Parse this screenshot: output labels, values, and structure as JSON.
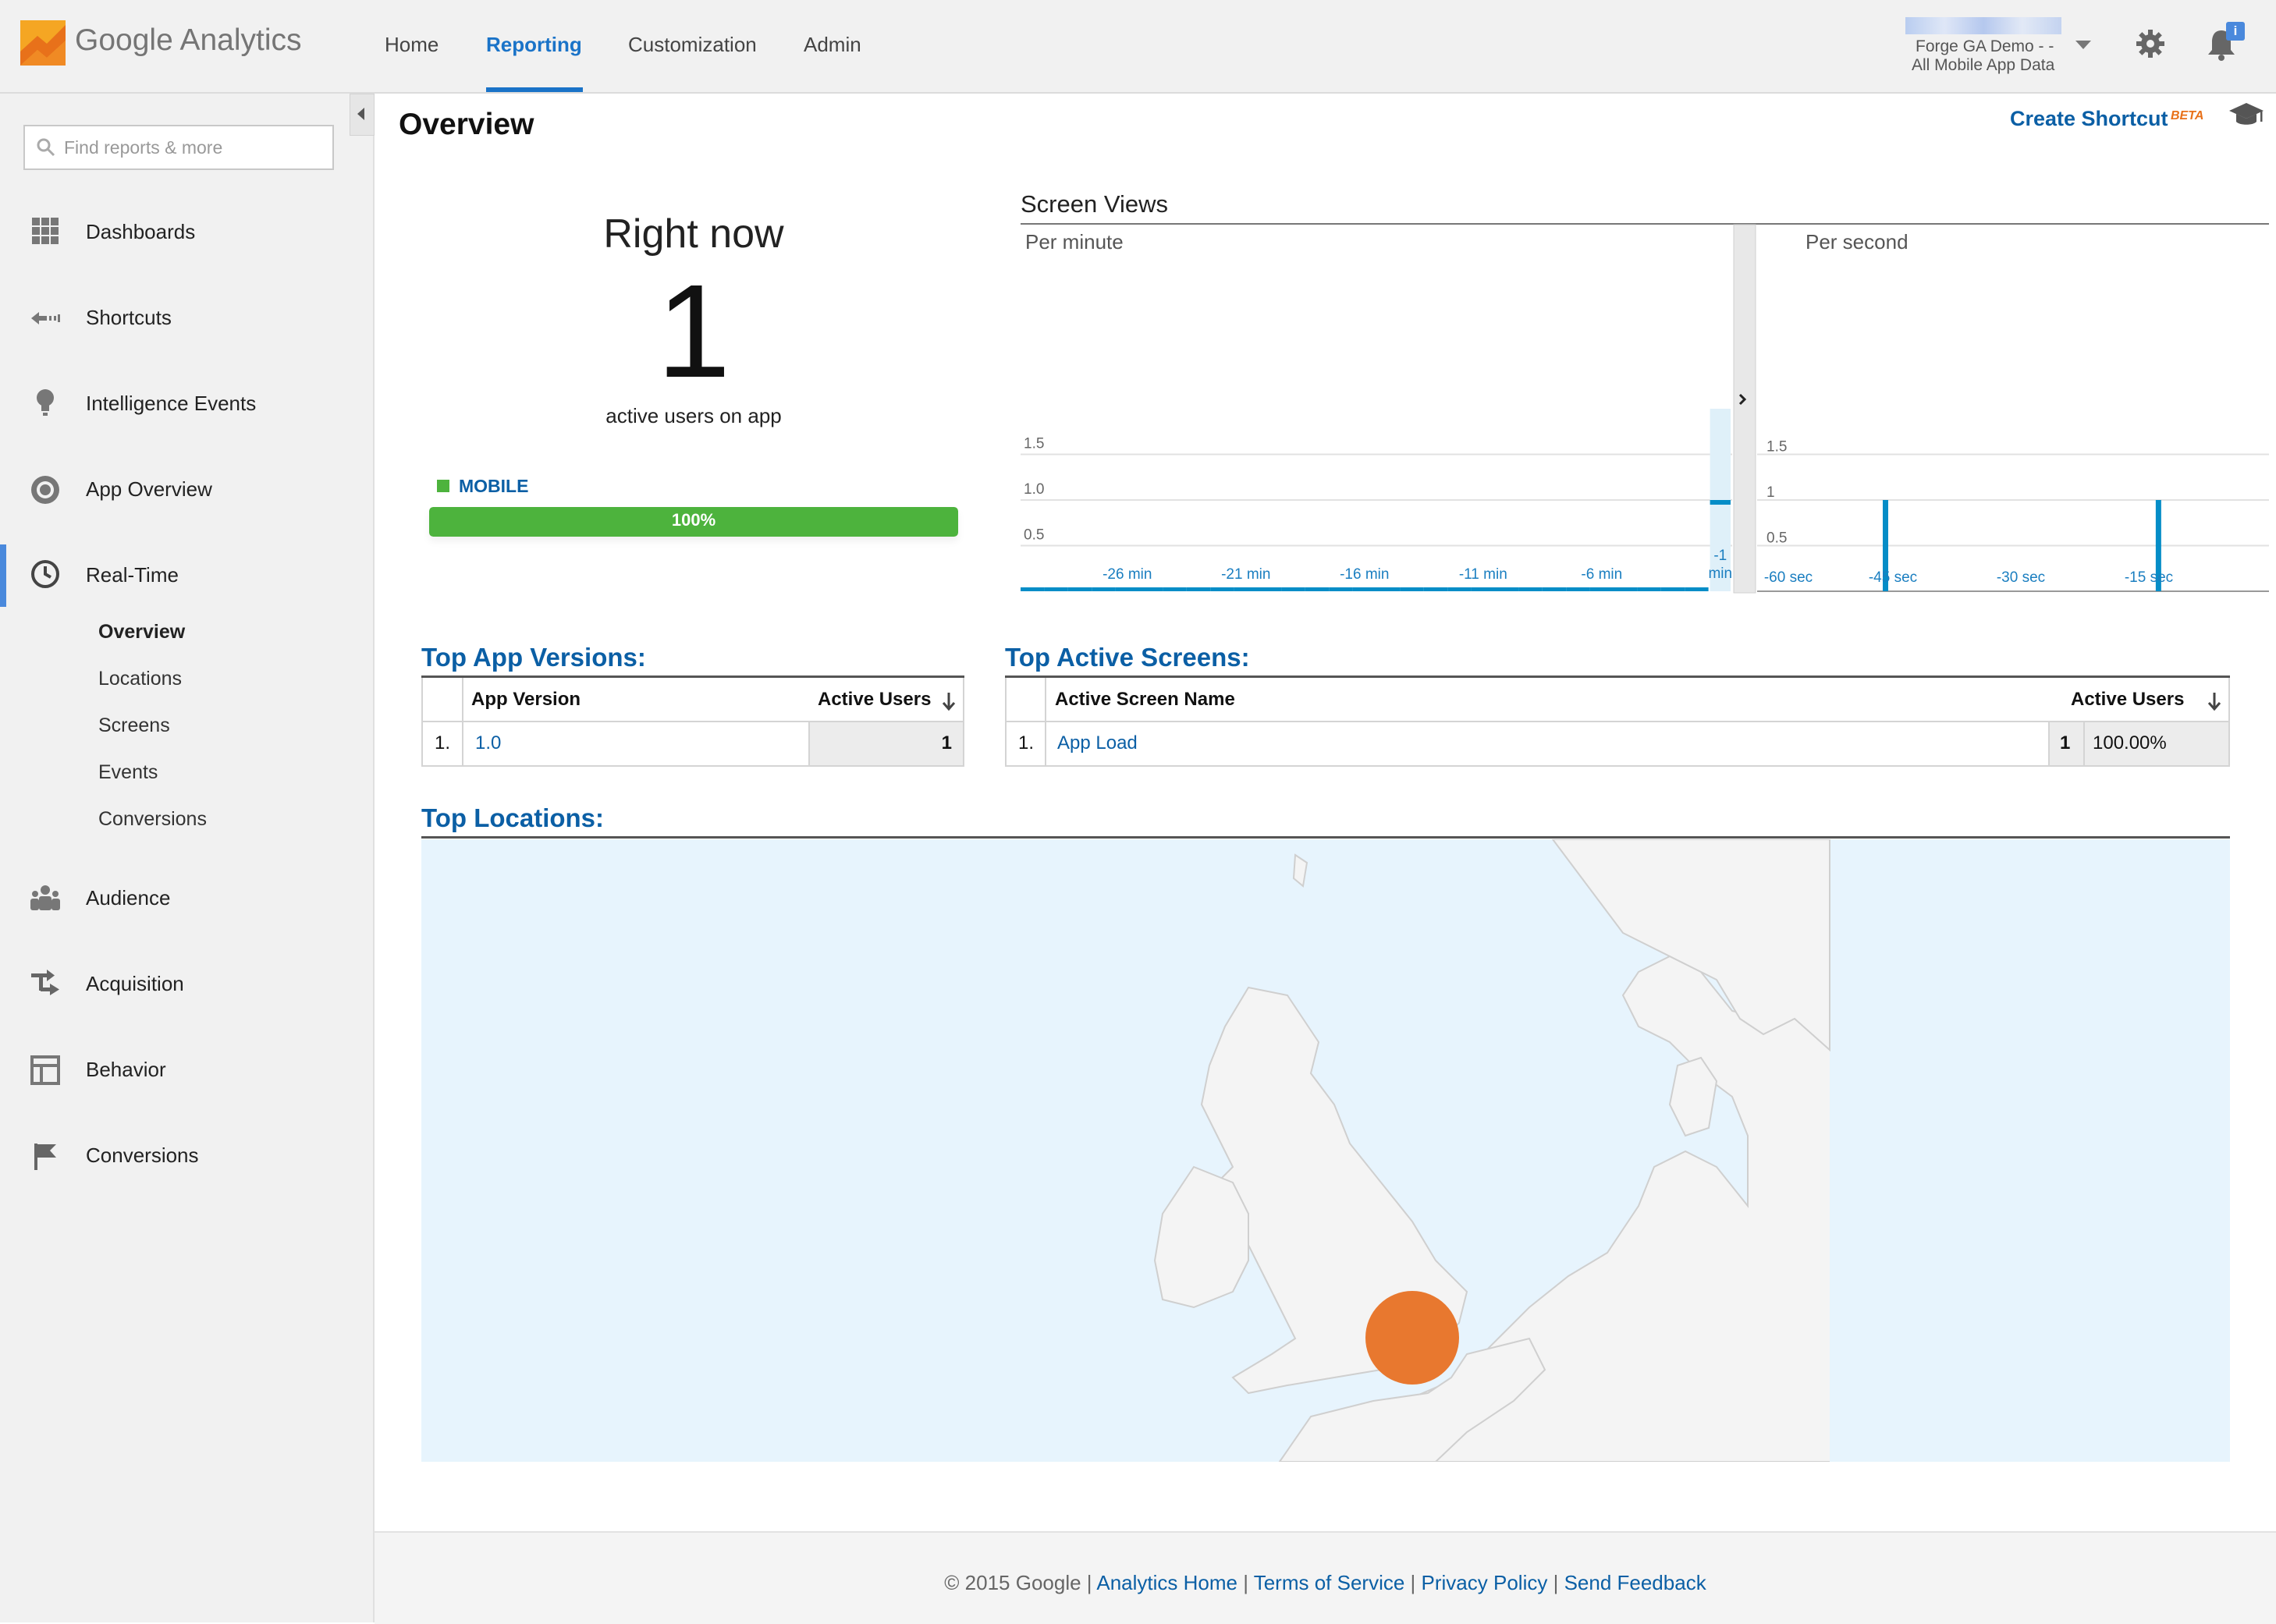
{
  "header": {
    "logo_text": "Google Analytics",
    "nav": [
      "Home",
      "Reporting",
      "Customization",
      "Admin"
    ],
    "active_nav": "Reporting",
    "account_line1": "Forge GA Demo - -",
    "account_line2": "All Mobile App Data",
    "notification_badge": "i",
    "icons": [
      "analytics-logo-icon",
      "gear-icon",
      "bell-icon"
    ]
  },
  "sidebar": {
    "search_placeholder": "Find reports & more",
    "items": [
      {
        "label": "Dashboards",
        "icon": "grid-icon"
      },
      {
        "label": "Shortcuts",
        "icon": "shortcut-arrow-icon"
      },
      {
        "label": "Intelligence Events",
        "icon": "lightbulb-icon"
      },
      {
        "label": "App Overview",
        "icon": "circle-icon"
      },
      {
        "label": "Real-Time",
        "icon": "clock-icon"
      },
      {
        "label": "Audience",
        "icon": "people-icon"
      },
      {
        "label": "Acquisition",
        "icon": "arrows-icon"
      },
      {
        "label": "Behavior",
        "icon": "layout-icon"
      },
      {
        "label": "Conversions",
        "icon": "flag-icon"
      }
    ],
    "realtime_sub": [
      "Overview",
      "Locations",
      "Screens",
      "Events",
      "Conversions"
    ],
    "active_sub": "Overview"
  },
  "content": {
    "page_title": "Overview",
    "create_shortcut": "Create Shortcut",
    "beta": "BETA",
    "right_now": {
      "title": "Right now",
      "value": "1",
      "subtitle": "active users on app",
      "segment_label": "MOBILE",
      "segment_percent": "100%",
      "segment_fraction": 1.0,
      "segment_color": "#4db33d"
    },
    "screen_views": {
      "title": "Screen Views",
      "per_minute_label": "Per minute",
      "per_second_label": "Per second"
    },
    "top_app_versions": {
      "title": "Top App Versions:",
      "headers": [
        "App Version",
        "Active Users"
      ],
      "rows": [
        {
          "rank": "1.",
          "name": "1.0",
          "value": "1"
        }
      ]
    },
    "top_active_screens": {
      "title": "Top Active Screens:",
      "headers": [
        "Active Screen Name",
        "Active Users"
      ],
      "rows": [
        {
          "rank": "1.",
          "name": "App Load",
          "value": "1",
          "percent": "100.00%"
        }
      ]
    },
    "top_locations": {
      "title": "Top Locations:",
      "bubble_color": "#e8782f"
    }
  },
  "footer": {
    "copyright": "© 2015 Google",
    "links": [
      "Analytics Home",
      "Terms of Service",
      "Privacy Policy",
      "Send Feedback"
    ]
  },
  "chart_data": [
    {
      "type": "bar",
      "title": "Per minute",
      "x_tick_labels": [
        "-26 min",
        "-21 min",
        "-16 min",
        "-11 min",
        "-6 min",
        "-1 min"
      ],
      "y_tick_labels": [
        "0.5",
        "1.0",
        "1.5"
      ],
      "ylim": [
        0,
        2
      ],
      "x": [
        -30,
        -29,
        -28,
        -27,
        -26,
        -25,
        -24,
        -23,
        -22,
        -21,
        -20,
        -19,
        -18,
        -17,
        -16,
        -15,
        -14,
        -13,
        -12,
        -11,
        -10,
        -9,
        -8,
        -7,
        -6,
        -5,
        -4,
        -3,
        -2,
        -1
      ],
      "values": [
        0,
        0,
        0,
        0,
        0,
        0,
        0,
        0,
        0,
        0,
        0,
        0,
        0,
        0,
        0,
        0,
        0,
        0,
        0,
        0,
        0,
        0,
        0,
        0,
        0,
        0,
        0,
        0,
        0,
        1
      ],
      "color": "#058dc7",
      "grid": true
    },
    {
      "type": "bar",
      "title": "Per second",
      "x_tick_labels": [
        "-60 sec",
        "-45 sec",
        "-30 sec",
        "-15 sec"
      ],
      "y_tick_labels": [
        "0.5",
        "1",
        "1.5"
      ],
      "ylim": [
        0,
        2
      ],
      "points": [
        {
          "x": -45,
          "y": 1
        },
        {
          "x": -13,
          "y": 1
        }
      ],
      "xlim": [
        -60,
        0
      ],
      "color": "#058dc7",
      "grid": true
    }
  ]
}
